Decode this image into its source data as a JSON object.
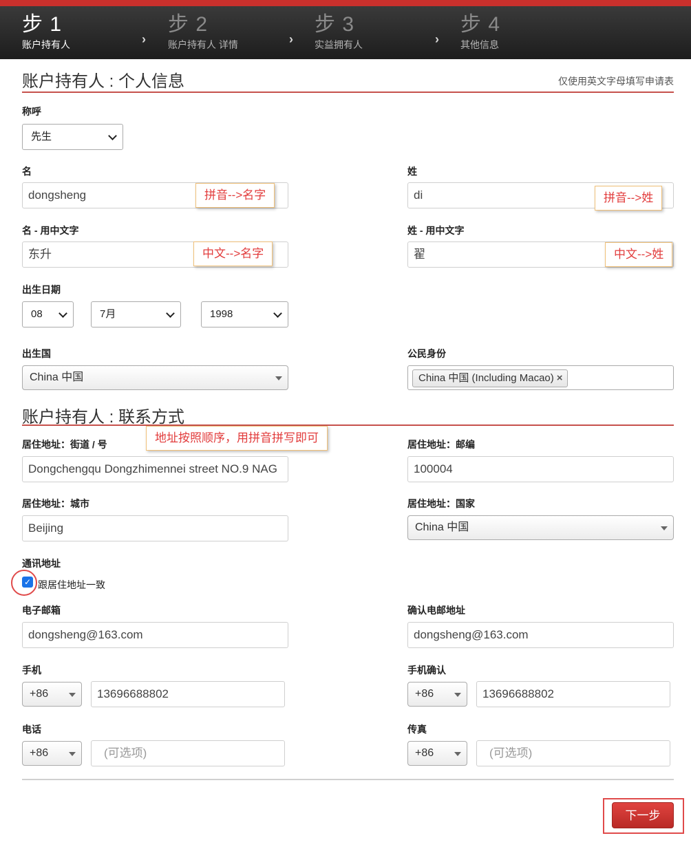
{
  "steps": [
    {
      "title": "步 1",
      "subtitle": "账户持有人"
    },
    {
      "title": "步 2",
      "subtitle": "账户持有人 详情"
    },
    {
      "title": "步 3",
      "subtitle": "实益拥有人"
    },
    {
      "title": "步 4",
      "subtitle": "其他信息"
    }
  ],
  "active_step": 1,
  "icons": {
    "step_separator": "chevron-right-icon",
    "dropdown": "chevron-down-icon",
    "remove_tag": "close-icon",
    "checkbox": "check-icon"
  },
  "colors": {
    "accent": "#c9302c",
    "note_text": "#e23c3c",
    "checkbox": "#1a73e8"
  },
  "personal": {
    "section_title": "账户持有人 : 个人信息",
    "lang_note": "仅使用英文字母填写申请表",
    "salutation": {
      "label": "称呼",
      "value": "先生"
    },
    "first_name": {
      "label": "名",
      "value": "dongsheng"
    },
    "last_name": {
      "label": "姓",
      "value": "di"
    },
    "first_name_cn": {
      "label": "名 - 用中文字",
      "value": "东升"
    },
    "last_name_cn": {
      "label": "姓 - 用中文字",
      "value": "翟"
    },
    "dob": {
      "label": "出生日期",
      "day": "08",
      "month": "7月",
      "year": "1998"
    },
    "birth_country": {
      "label": "出生国",
      "value": "China 中国"
    },
    "citizenship": {
      "label": "公民身份",
      "tag": "China 中国 (Including Macao)",
      "remove": "×"
    }
  },
  "contact": {
    "section_title": "账户持有人 : 联系方式",
    "street": {
      "label": "居住地址：街道 / 号",
      "value": "Dongchengqu Dongzhimennei street NO.9 NAG"
    },
    "postal": {
      "label": "居住地址：邮编",
      "value": "100004"
    },
    "city": {
      "label": "居住地址：城市",
      "value": "Beijing"
    },
    "country": {
      "label": "居住地址：国家",
      "value": "China 中国"
    },
    "mailing": {
      "label": "通讯地址",
      "same_label": "跟居住地址一致",
      "checked": true
    },
    "email": {
      "label": "电子邮箱",
      "value": "dongsheng@163.com"
    },
    "email_confirm": {
      "label": "确认电邮地址",
      "value": "dongsheng@163.com"
    },
    "mobile": {
      "label": "手机",
      "code": "+86",
      "value": "13696688802"
    },
    "mobile_confirm": {
      "label": "手机确认",
      "code": "+86",
      "value": "13696688802"
    },
    "phone": {
      "label": "电话",
      "code": "+86",
      "placeholder": "(可选项)"
    },
    "fax": {
      "label": "传真",
      "code": "+86",
      "placeholder": "(可选项)"
    }
  },
  "annotations": {
    "first_name": "拼音-->名字",
    "last_name": "拼音-->姓",
    "first_name_cn": "中文-->名字",
    "last_name_cn": "中文-->姓",
    "address": "地址按照顺序，用拼音拼写即可"
  },
  "actions": {
    "next_label": "下一步"
  }
}
